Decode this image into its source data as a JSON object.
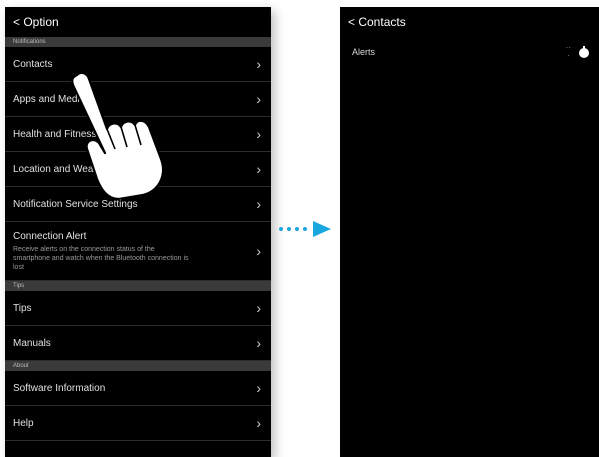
{
  "left_phone": {
    "nav": {
      "back_icon": "chevron-left-icon",
      "title": "< Option"
    },
    "sections": [
      {
        "header": "Notifications",
        "rows": [
          {
            "label": "Contacts",
            "subtitle": ""
          },
          {
            "label": "Apps and Media",
            "subtitle": ""
          },
          {
            "label": "Health and Fitness",
            "subtitle": ""
          },
          {
            "label": "Location and Weather",
            "subtitle": ""
          },
          {
            "label": "Notification Service Settings",
            "subtitle": ""
          },
          {
            "label": "Connection Alert",
            "subtitle": "Receive alerts on the connection status of the smartphone and watch when the Bluetooth connection is lost"
          }
        ]
      },
      {
        "header": "Tips",
        "rows": [
          {
            "label": "Tips",
            "subtitle": ""
          },
          {
            "label": "Manuals",
            "subtitle": ""
          }
        ]
      },
      {
        "header": "About",
        "rows": [
          {
            "label": "Software Information",
            "subtitle": ""
          },
          {
            "label": "Help",
            "subtitle": ""
          }
        ]
      }
    ]
  },
  "right_phone": {
    "nav": {
      "back_icon": "chevron-left-icon",
      "title": "< Contacts"
    },
    "row": {
      "label": "Alerts",
      "toggle_state": "on"
    }
  },
  "transition": {
    "arrow_icon": "dotted-arrow-right-icon",
    "color": "#1aa7e0"
  },
  "gesture": {
    "icon": "tap-hand-icon"
  }
}
